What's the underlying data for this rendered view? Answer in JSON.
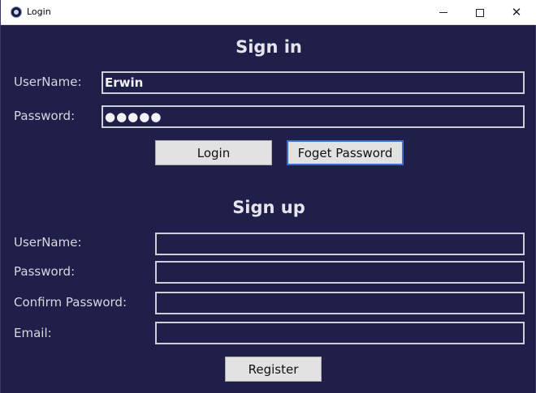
{
  "window": {
    "title": "Login",
    "controls": {
      "minimize": "minimize-icon",
      "maximize": "maximize-icon",
      "close": "close-icon"
    }
  },
  "signin": {
    "heading": "Sign in",
    "username_label": "UserName:",
    "username_value": "Erwin",
    "password_label": "Password:",
    "password_value": "●●●●●",
    "login_label": "Login",
    "forgot_label": "Foget Password"
  },
  "signup": {
    "heading": "Sign up",
    "username_label": "UserName:",
    "password_label": "Password:",
    "confirm_label": "Confirm Password:",
    "email_label": "Email:",
    "username_value": "",
    "password_value": "",
    "confirm_value": "",
    "email_value": "",
    "register_label": "Register"
  },
  "colors": {
    "background": "#1f1f4a",
    "field_border": "#cfcfda",
    "button_face": "#e2e2e2",
    "focus_border": "#3a6fd0"
  }
}
